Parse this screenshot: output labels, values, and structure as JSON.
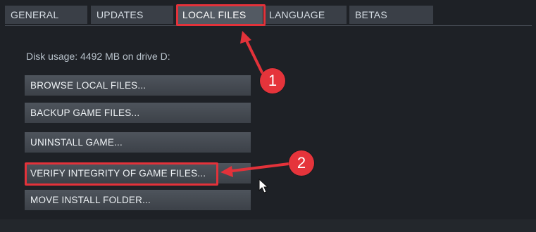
{
  "tabs": [
    {
      "label": "GENERAL"
    },
    {
      "label": "UPDATES"
    },
    {
      "label": "LOCAL FILES",
      "active": true
    },
    {
      "label": "LANGUAGE"
    },
    {
      "label": "BETAS"
    }
  ],
  "disk_usage": "Disk usage: 4492 MB on drive D:",
  "buttons": [
    {
      "label": "BROWSE LOCAL FILES..."
    },
    {
      "label": "BACKUP GAME FILES..."
    },
    {
      "label": "UNINSTALL GAME..."
    },
    {
      "label": "VERIFY INTEGRITY OF GAME FILES..."
    },
    {
      "label": "MOVE INSTALL FOLDER..."
    }
  ],
  "annotations": {
    "step1": "1",
    "step2": "2",
    "color": "#e3323a"
  },
  "icons": {
    "cursor": "mouse-pointer-icon"
  }
}
